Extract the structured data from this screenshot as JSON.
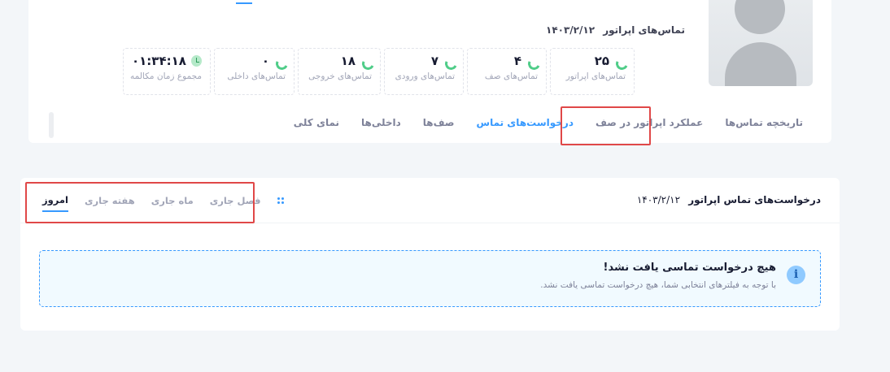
{
  "profile": {
    "subtitle": "تماس‌های اپراتور",
    "date": "۱۴۰۳/۲/۱۲"
  },
  "stats": [
    {
      "value": "۲۵",
      "label": "تماس‌های اپراتور",
      "icon": "phone-icon"
    },
    {
      "value": "۴",
      "label": "تماس‌های صف",
      "icon": "phone-icon"
    },
    {
      "value": "۷",
      "label": "تماس‌های ورودی",
      "icon": "phone-incoming-icon"
    },
    {
      "value": "۱۸",
      "label": "تماس‌های خروجی",
      "icon": "phone-outgoing-icon"
    },
    {
      "value": "۰",
      "label": "تماس‌های داخلی",
      "icon": "phone-icon"
    },
    {
      "value": "۰۱:۳۴:۱۸",
      "label": "مجموع زمان مکالمه",
      "icon": "clock-icon"
    }
  ],
  "tabs": [
    {
      "label": "نمای کلی"
    },
    {
      "label": "داخلی‌ها"
    },
    {
      "label": "صف‌ها"
    },
    {
      "label": "درخواست‌های تماس",
      "active": true
    },
    {
      "label": "عملکرد اپراتور در صف"
    },
    {
      "label": "تاریخچه تماس‌ها"
    }
  ],
  "card": {
    "title": "درخواست‌های تماس اپراتور",
    "date": "۱۴۰۳/۲/۱۲",
    "periods": [
      {
        "label": "امروز",
        "active": true
      },
      {
        "label": "هفته جاری"
      },
      {
        "label": "ماه جاری"
      },
      {
        "label": "فصل جاری"
      }
    ]
  },
  "notice": {
    "icon": "i",
    "title": "هیچ درخواست تماسی یافت نشد!",
    "text": "با توجه به فیلترهای انتخابی شما، هیچ درخواست تماسی یافت نشد."
  },
  "colors": {
    "accent": "#3699ff",
    "success": "#50cd89",
    "highlight": "#e04848"
  }
}
